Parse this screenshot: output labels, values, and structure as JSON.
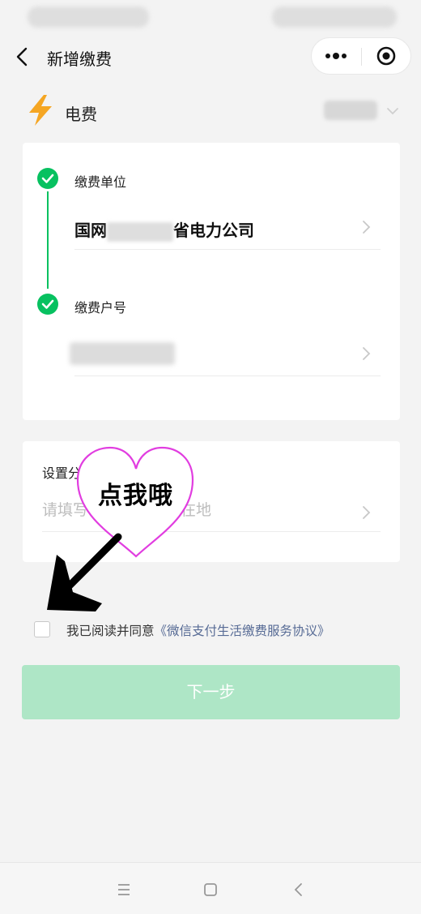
{
  "nav": {
    "title": "新增缴费"
  },
  "bill_type": {
    "label": "电费"
  },
  "steps": {
    "unit_label": "缴费单位",
    "unit_value_prefix": "国网",
    "unit_value_suffix": "省电力公司",
    "account_label": "缴费户号"
  },
  "group": {
    "label": "设置分组",
    "placeholder": "请填写小区或房屋所在地"
  },
  "annotation": {
    "heart_text": "点我哦"
  },
  "agreement": {
    "prefix": "我已阅读并同意",
    "link": "《微信支付生活缴费服务协议》"
  },
  "next_button": {
    "label": "下一步"
  },
  "colors": {
    "accent_green": "#07c160",
    "button_disabled": "#aee6c6",
    "link_blue": "#576b95",
    "bolt_orange": "#f5a623",
    "heart_magenta": "#e13de0"
  },
  "icons": [
    "back-icon",
    "more-dots-icon",
    "target-icon",
    "lightning-bolt-icon",
    "chevron-down-icon",
    "checkmark-circle-icon",
    "chevron-right-icon",
    "menu-icon",
    "home-square-icon",
    "back-triangle-icon"
  ]
}
